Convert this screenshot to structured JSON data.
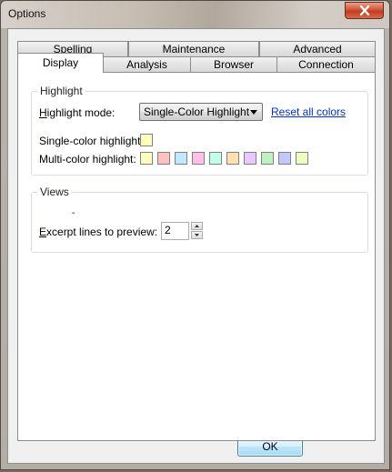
{
  "window": {
    "title": "Options"
  },
  "tabs": {
    "row_back": [
      "Spelling",
      "Maintenance",
      "Advanced"
    ],
    "row_front": [
      "Display",
      "Analysis",
      "Browser",
      "Connection"
    ],
    "active": "Display"
  },
  "highlight": {
    "group_title": "Highlight",
    "mode_label_prefix": "H",
    "mode_label_rest": "ighlight mode:",
    "mode_value": "Single-Color Highlight",
    "reset_link": "Reset all colors",
    "single_label": "Single-color highlight:",
    "multi_label": "Multi-color highlight:",
    "single_color": "#ffffc0",
    "multi_colors": [
      "#ffffc0",
      "#ffc0c0",
      "#c0e8ff",
      "#ffc0e8",
      "#c0ffe8",
      "#ffe0b0",
      "#e8c8ff",
      "#c0f0c0",
      "#c0c8ff",
      "#e8ffc0"
    ]
  },
  "views": {
    "group_title": "Views",
    "minor_mark": "-",
    "excerpt_label_prefix": "E",
    "excerpt_label_rest": "xcerpt lines to preview:",
    "excerpt_value": "2"
  },
  "footer": {
    "ok_label": "OK"
  },
  "colors": {
    "link": "#0033cc",
    "close_red": "#c23a20",
    "ok_border": "#3c7fb1"
  }
}
